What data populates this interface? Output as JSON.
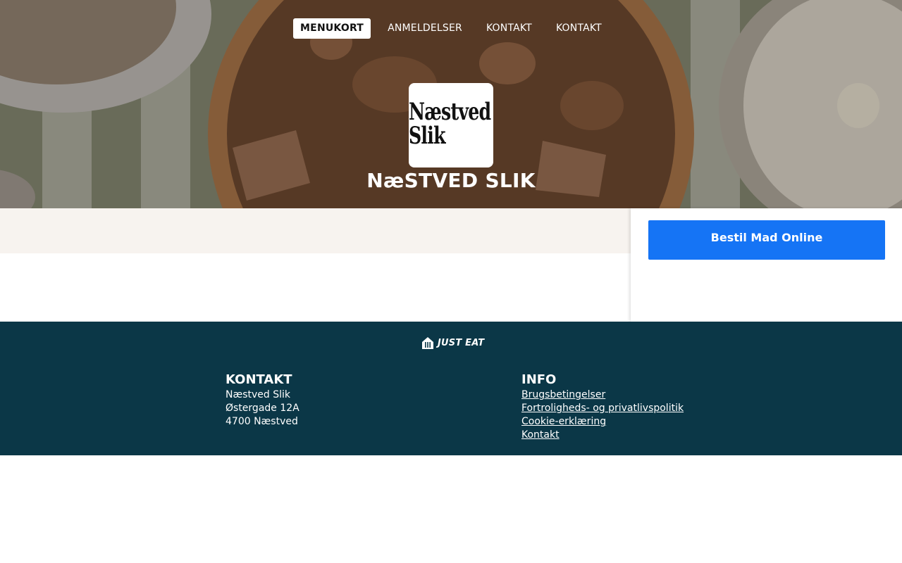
{
  "nav": {
    "items": [
      {
        "label": "MENUKORT",
        "active": true
      },
      {
        "label": "ANMELDELSER",
        "active": false
      },
      {
        "label": "KONTAKT",
        "active": false
      },
      {
        "label": "KONTAKT",
        "active": false
      }
    ]
  },
  "restaurant": {
    "logo_line1": "Næstved",
    "logo_line2": "Slik",
    "name": "NæSTVED SLIK"
  },
  "sidebar": {
    "order_button": "Bestil Mad Online"
  },
  "footer": {
    "brand": "JUST EAT",
    "contact": {
      "heading": "KONTAKT",
      "lines": [
        "Næstved Slik",
        "Østergade 12A",
        "4700 Næstved"
      ]
    },
    "info": {
      "heading": "INFO",
      "links": [
        "Brugsbetingelser",
        "Fortroligheds- og privatlivspolitik",
        "Cookie-erklæring",
        "Kontakt"
      ]
    }
  },
  "colors": {
    "order_button": "#1574f5",
    "footer_bg": "#0b3747",
    "main_band": "#f7f3ef"
  }
}
